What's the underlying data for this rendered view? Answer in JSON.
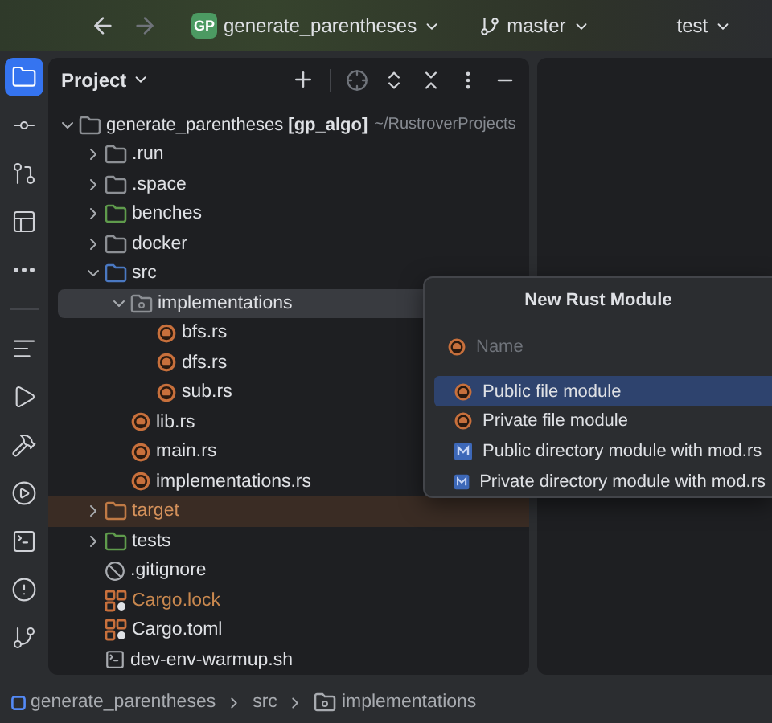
{
  "title_bar": {
    "project_badge": "GP",
    "project": "generate_parentheses",
    "branch": "master",
    "run_config": "test"
  },
  "top_tools": [
    {
      "kind": "project",
      "selected": true
    },
    {
      "kind": "commit",
      "selected": false
    },
    {
      "kind": "pull-requests",
      "selected": false
    },
    {
      "kind": "structure",
      "selected": false
    },
    {
      "kind": "more",
      "selected": false
    }
  ],
  "bottom_tools": [
    {
      "kind": "todo",
      "selected": false
    },
    {
      "kind": "run",
      "selected": false
    },
    {
      "kind": "build",
      "selected": false
    },
    {
      "kind": "services",
      "selected": false
    },
    {
      "kind": "terminal",
      "selected": false
    },
    {
      "kind": "problems",
      "selected": false
    },
    {
      "kind": "git",
      "selected": false
    }
  ],
  "project_panel": {
    "title": "Project",
    "tree": [
      {
        "kind": "folder",
        "label": "generate_parentheses **[gp_algo]**",
        "path": "~/RustroverProjects",
        "color": "#8c8f94",
        "expanded": true,
        "selected": false,
        "children": [
          {
            "kind": "folder",
            "label": ".run",
            "color": "#8c8f94",
            "expanded": false,
            "selected": false
          },
          {
            "kind": "folder",
            "label": ".space",
            "color": "#8c8f94",
            "expanded": false,
            "selected": false
          },
          {
            "kind": "folder",
            "label": "benches",
            "color": "#5f9b4c",
            "expanded": false,
            "selected": false
          },
          {
            "kind": "folder",
            "label": "docker",
            "color": "#8c8f94",
            "expanded": false,
            "selected": false
          },
          {
            "kind": "folder",
            "label": "src",
            "color": "#4a78c2",
            "expanded": true,
            "selected": false,
            "children": [
              {
                "kind": "module-folder",
                "label": "implementations",
                "color": "#8c8f94",
                "expanded": true,
                "selected": true,
                "children": [
                  {
                    "kind": "rust",
                    "label": "bfs.rs",
                    "selected": false
                  },
                  {
                    "kind": "rust",
                    "label": "dfs.rs",
                    "selected": false
                  },
                  {
                    "kind": "rust",
                    "label": "sub.rs",
                    "selected": false
                  }
                ]
              },
              {
                "kind": "rust",
                "label": "lib.rs",
                "selected": false
              },
              {
                "kind": "rust",
                "label": "main.rs",
                "selected": false
              },
              {
                "kind": "rust",
                "label": "implementations.rs",
                "selected": false
              }
            ]
          },
          {
            "kind": "folder",
            "label": "target",
            "color": "#c07a45",
            "excluded": true,
            "expanded": false,
            "selected": false
          },
          {
            "kind": "folder",
            "label": "tests",
            "color": "#5f9b4c",
            "expanded": false,
            "selected": false
          },
          {
            "kind": "ignore",
            "label": ".gitignore",
            "selected": false
          },
          {
            "kind": "cargo",
            "label": "Cargo.lock",
            "ignored": true,
            "selected": false
          },
          {
            "kind": "cargo",
            "label": "Cargo.toml",
            "selected": false
          },
          {
            "kind": "shell",
            "label": "dev-env-warmup.sh",
            "selected": false
          }
        ]
      }
    ]
  },
  "new_module_popup": {
    "title": "New Rust Module",
    "name_field": {
      "placeholder": "Name"
    },
    "options": [
      {
        "kind": "file",
        "label": "Public file module",
        "selected": true
      },
      {
        "kind": "file",
        "label": "Private file module",
        "selected": false
      },
      {
        "kind": "directory",
        "label": "Public directory module with mod.rs",
        "selected": false
      },
      {
        "kind": "directory",
        "label": "Private directory module with mod.rs",
        "selected": false
      }
    ]
  },
  "breadcrumbs": [
    {
      "kind": "module",
      "label": "generate_parentheses"
    },
    {
      "kind": "plain",
      "label": "src"
    },
    {
      "kind": "folder",
      "label": "implementations"
    }
  ]
}
